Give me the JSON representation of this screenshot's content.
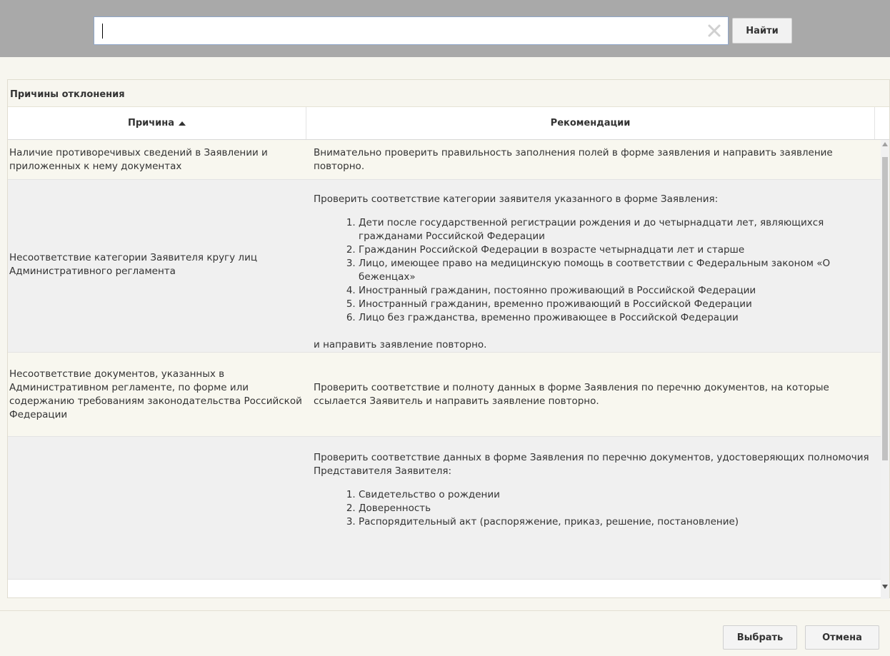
{
  "search": {
    "value": "",
    "button_label": "Найти",
    "clear_icon": "clear-x-icon"
  },
  "panel": {
    "title": "Причины отклонения",
    "columns": {
      "cause": "Причина",
      "recommendations": "Рекомендации",
      "sort_icon": "sort-ascending-icon"
    },
    "rows": [
      {
        "cause": "Наличие противоречивых сведений в Заявлении и приложенных к нему документах",
        "rec_intro": "Внимательно проверить правильность заполнения полей в форме заявления и направить заявление повторно."
      },
      {
        "cause": "Несоответствие категории Заявителя кругу лиц Административного регламента",
        "rec_intro": "Проверить соответствие категории заявителя указанного в форме Заявления:",
        "rec_list": [
          "Дети после государственной регистрации рождения и до четырнадцати лет, являющихся гражданами Российской Федерации",
          "Гражданин Российской Федерации в возрасте четырнадцати лет и старше",
          "Лицо, имеющее право на медицинскую помощь в соответствии с Федеральным законом «О беженцах»",
          "Иностранный гражданин, постоянно проживающий в Российской Федерации",
          "Иностранный гражданин, временно проживающий в Российской Федерации",
          "Лицо без гражданства, временно проживающее в Российской Федерации"
        ],
        "rec_after": "и направить заявление повторно."
      },
      {
        "cause": "Несоответствие документов, указанных в Административном регламенте, по форме или содержанию требованиям законодательства Российской Федерации",
        "rec_intro": "Проверить соответствие и полноту данных в форме Заявления по перечню документов, на которые ссылается Заявитель и направить заявление повторно."
      },
      {
        "cause": "",
        "rec_intro": "Проверить соответствие данных в форме Заявления по перечню документов, удостоверяющих полномочия Представителя Заявителя:",
        "rec_list": [
          "Свидетельство о рождении",
          "Доверенность",
          "Распорядительный акт (распоряжение, приказ, решение, постановление)"
        ]
      }
    ]
  },
  "footer": {
    "select_label": "Выбрать",
    "cancel_label": "Отмена"
  }
}
